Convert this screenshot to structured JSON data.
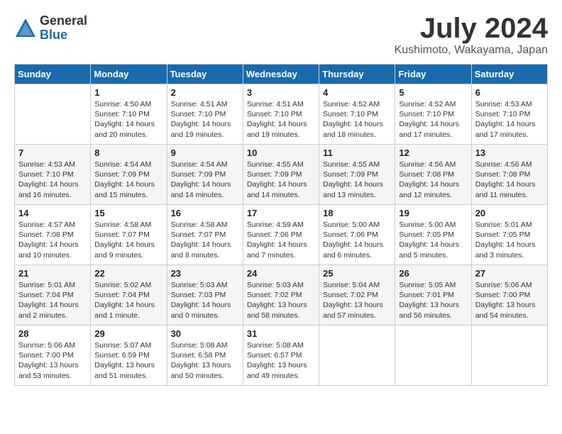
{
  "header": {
    "logo_general": "General",
    "logo_blue": "Blue",
    "title": "July 2024",
    "location": "Kushimoto, Wakayama, Japan"
  },
  "days_of_week": [
    "Sunday",
    "Monday",
    "Tuesday",
    "Wednesday",
    "Thursday",
    "Friday",
    "Saturday"
  ],
  "weeks": [
    [
      {
        "day": "",
        "info": ""
      },
      {
        "day": "1",
        "info": "Sunrise: 4:50 AM\nSunset: 7:10 PM\nDaylight: 14 hours\nand 20 minutes."
      },
      {
        "day": "2",
        "info": "Sunrise: 4:51 AM\nSunset: 7:10 PM\nDaylight: 14 hours\nand 19 minutes."
      },
      {
        "day": "3",
        "info": "Sunrise: 4:51 AM\nSunset: 7:10 PM\nDaylight: 14 hours\nand 19 minutes."
      },
      {
        "day": "4",
        "info": "Sunrise: 4:52 AM\nSunset: 7:10 PM\nDaylight: 14 hours\nand 18 minutes."
      },
      {
        "day": "5",
        "info": "Sunrise: 4:52 AM\nSunset: 7:10 PM\nDaylight: 14 hours\nand 17 minutes."
      },
      {
        "day": "6",
        "info": "Sunrise: 4:53 AM\nSunset: 7:10 PM\nDaylight: 14 hours\nand 17 minutes."
      }
    ],
    [
      {
        "day": "7",
        "info": "Sunrise: 4:53 AM\nSunset: 7:10 PM\nDaylight: 14 hours\nand 16 minutes."
      },
      {
        "day": "8",
        "info": "Sunrise: 4:54 AM\nSunset: 7:09 PM\nDaylight: 14 hours\nand 15 minutes."
      },
      {
        "day": "9",
        "info": "Sunrise: 4:54 AM\nSunset: 7:09 PM\nDaylight: 14 hours\nand 14 minutes."
      },
      {
        "day": "10",
        "info": "Sunrise: 4:55 AM\nSunset: 7:09 PM\nDaylight: 14 hours\nand 14 minutes."
      },
      {
        "day": "11",
        "info": "Sunrise: 4:55 AM\nSunset: 7:09 PM\nDaylight: 14 hours\nand 13 minutes."
      },
      {
        "day": "12",
        "info": "Sunrise: 4:56 AM\nSunset: 7:08 PM\nDaylight: 14 hours\nand 12 minutes."
      },
      {
        "day": "13",
        "info": "Sunrise: 4:56 AM\nSunset: 7:08 PM\nDaylight: 14 hours\nand 11 minutes."
      }
    ],
    [
      {
        "day": "14",
        "info": "Sunrise: 4:57 AM\nSunset: 7:08 PM\nDaylight: 14 hours\nand 10 minutes."
      },
      {
        "day": "15",
        "info": "Sunrise: 4:58 AM\nSunset: 7:07 PM\nDaylight: 14 hours\nand 9 minutes."
      },
      {
        "day": "16",
        "info": "Sunrise: 4:58 AM\nSunset: 7:07 PM\nDaylight: 14 hours\nand 8 minutes."
      },
      {
        "day": "17",
        "info": "Sunrise: 4:59 AM\nSunset: 7:06 PM\nDaylight: 14 hours\nand 7 minutes."
      },
      {
        "day": "18",
        "info": "Sunrise: 5:00 AM\nSunset: 7:06 PM\nDaylight: 14 hours\nand 6 minutes."
      },
      {
        "day": "19",
        "info": "Sunrise: 5:00 AM\nSunset: 7:05 PM\nDaylight: 14 hours\nand 5 minutes."
      },
      {
        "day": "20",
        "info": "Sunrise: 5:01 AM\nSunset: 7:05 PM\nDaylight: 14 hours\nand 3 minutes."
      }
    ],
    [
      {
        "day": "21",
        "info": "Sunrise: 5:01 AM\nSunset: 7:04 PM\nDaylight: 14 hours\nand 2 minutes."
      },
      {
        "day": "22",
        "info": "Sunrise: 5:02 AM\nSunset: 7:04 PM\nDaylight: 14 hours\nand 1 minute."
      },
      {
        "day": "23",
        "info": "Sunrise: 5:03 AM\nSunset: 7:03 PM\nDaylight: 14 hours\nand 0 minutes."
      },
      {
        "day": "24",
        "info": "Sunrise: 5:03 AM\nSunset: 7:02 PM\nDaylight: 13 hours\nand 58 minutes."
      },
      {
        "day": "25",
        "info": "Sunrise: 5:04 AM\nSunset: 7:02 PM\nDaylight: 13 hours\nand 57 minutes."
      },
      {
        "day": "26",
        "info": "Sunrise: 5:05 AM\nSunset: 7:01 PM\nDaylight: 13 hours\nand 56 minutes."
      },
      {
        "day": "27",
        "info": "Sunrise: 5:06 AM\nSunset: 7:00 PM\nDaylight: 13 hours\nand 54 minutes."
      }
    ],
    [
      {
        "day": "28",
        "info": "Sunrise: 5:06 AM\nSunset: 7:00 PM\nDaylight: 13 hours\nand 53 minutes."
      },
      {
        "day": "29",
        "info": "Sunrise: 5:07 AM\nSunset: 6:59 PM\nDaylight: 13 hours\nand 51 minutes."
      },
      {
        "day": "30",
        "info": "Sunrise: 5:08 AM\nSunset: 6:58 PM\nDaylight: 13 hours\nand 50 minutes."
      },
      {
        "day": "31",
        "info": "Sunrise: 5:08 AM\nSunset: 6:57 PM\nDaylight: 13 hours\nand 49 minutes."
      },
      {
        "day": "",
        "info": ""
      },
      {
        "day": "",
        "info": ""
      },
      {
        "day": "",
        "info": ""
      }
    ]
  ]
}
